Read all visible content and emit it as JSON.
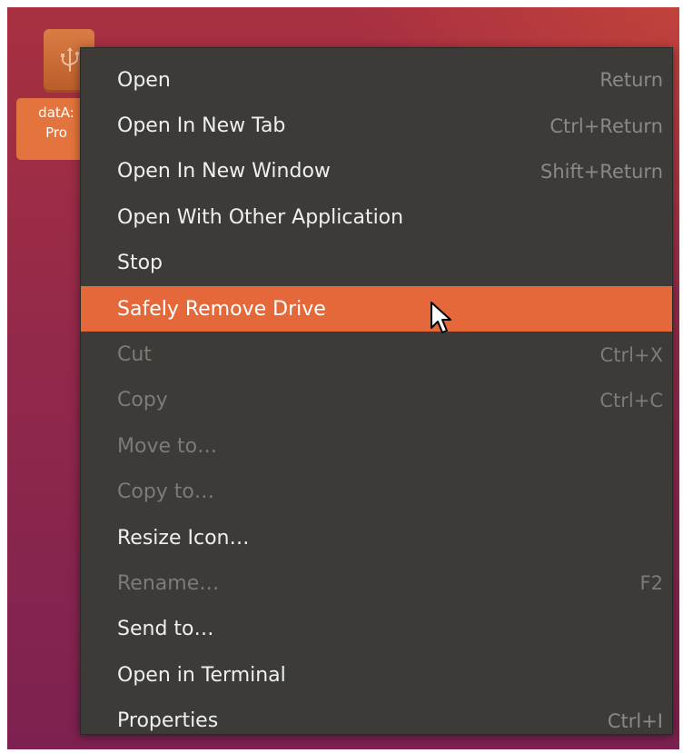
{
  "desktop": {
    "drive_label": "datA:\nPro"
  },
  "menu": {
    "items": [
      {
        "label": "Open",
        "shortcut": "Return",
        "enabled": true
      },
      {
        "label": "Open In New Tab",
        "shortcut": "Ctrl+Return",
        "enabled": true
      },
      {
        "label": "Open In New Window",
        "shortcut": "Shift+Return",
        "enabled": true
      },
      {
        "label": "Open With Other Application",
        "shortcut": "",
        "enabled": true
      },
      {
        "label": "Stop",
        "shortcut": "",
        "enabled": true
      },
      {
        "label": "Safely Remove Drive",
        "shortcut": "",
        "enabled": true,
        "highlighted": true
      },
      {
        "label": "Cut",
        "shortcut": "Ctrl+X",
        "enabled": false
      },
      {
        "label": "Copy",
        "shortcut": "Ctrl+C",
        "enabled": false
      },
      {
        "label": "Move to…",
        "shortcut": "",
        "enabled": false
      },
      {
        "label": "Copy to…",
        "shortcut": "",
        "enabled": false
      },
      {
        "label": "Resize Icon…",
        "shortcut": "",
        "enabled": true
      },
      {
        "label": "Rename…",
        "shortcut": "F2",
        "enabled": false
      },
      {
        "label": "Send to…",
        "shortcut": "",
        "enabled": true
      },
      {
        "label": "Open in Terminal",
        "shortcut": "",
        "enabled": true
      },
      {
        "label": "Properties",
        "shortcut": "Ctrl+I",
        "enabled": true
      }
    ]
  },
  "colors": {
    "menu_background": "#3c3b37",
    "highlight": "#e4683a",
    "enabled_text": "#efefef",
    "disabled_text": "#7c7b77",
    "shortcut_text": "#8a8985",
    "drive_label_background": "#e3743d"
  },
  "icons": {
    "drive": "usb-drive-icon",
    "cursor": "mouse-pointer-icon"
  }
}
